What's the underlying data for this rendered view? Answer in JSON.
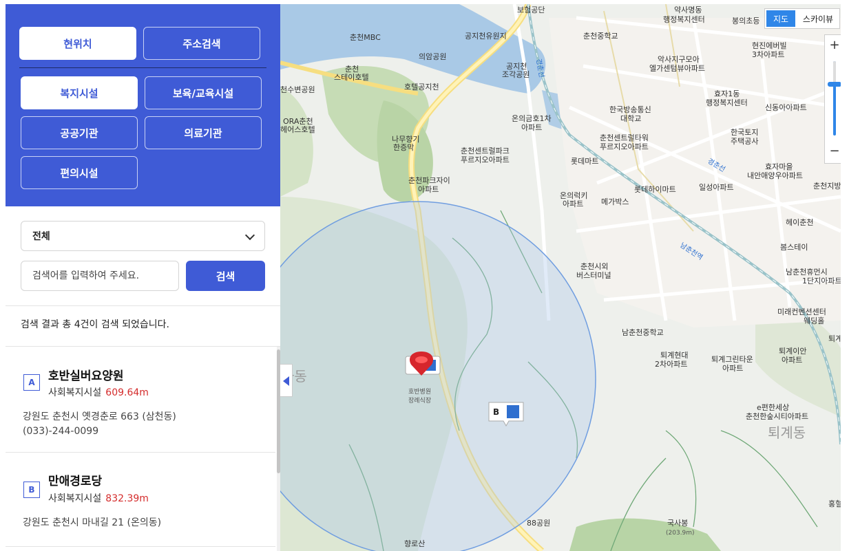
{
  "top_buttons": {
    "current_location": "현위치",
    "address_search": "주소검색"
  },
  "categories": [
    {
      "label": "복지시설"
    },
    {
      "label": "보육/교육시설"
    },
    {
      "label": "공공기관"
    },
    {
      "label": "의료기관"
    },
    {
      "label": "편의시설"
    }
  ],
  "filter": {
    "selected": "전체"
  },
  "search": {
    "placeholder": "검색어를 입력하여 주세요.",
    "button": "검색"
  },
  "result_summary": "검색 결과 총 4건이 검색 되었습니다.",
  "results": [
    {
      "marker": "A",
      "name": "호반실버요양원",
      "category": "사회복지시설",
      "distance": "609.64m",
      "address": "강원도 춘천시 옛경춘로 663 (삼천동)",
      "phone": "(033)-244-0099"
    },
    {
      "marker": "B",
      "name": "만애경로당",
      "category": "사회복지시설",
      "distance": "832.39m",
      "address": "강원도 춘천시 마내길  21 (온의동)"
    }
  ],
  "map": {
    "map_type": {
      "map": "지도",
      "skyview": "스카이뷰"
    },
    "zoom": {
      "plus": "+",
      "minus": "−"
    },
    "marker_b": "B",
    "center_label": [
      "호반병원",
      "장례식장"
    ],
    "labels": [
      [
        "보험공단"
      ],
      [
        "약사명동",
        "행정복지센터"
      ],
      [
        "봉의초등"
      ],
      [
        "춘천MBC"
      ],
      [
        "공지천유원지"
      ],
      [
        "춘천중학교"
      ],
      [
        "의암공원"
      ],
      [
        "현진에버빌",
        "3차아파트"
      ],
      [
        "춘천",
        "스테이호텔"
      ],
      [
        "공지천",
        "조각공원"
      ],
      [
        "악사지구모아",
        "엘가센텀뷰아파트"
      ],
      [
        "호텔공지천"
      ],
      [
        "천수변공원"
      ],
      [
        "효자1동",
        "행정복지센터"
      ],
      [
        "한국방송통신",
        "대학교"
      ],
      [
        "신동아아파트"
      ],
      [
        "ORA춘천",
        "헤어스호텔"
      ],
      [
        "온의금호1차",
        "아파트"
      ],
      [
        "춘천센트럴타워",
        "푸르지오아파트"
      ],
      [
        "나무향기",
        "한증막"
      ],
      [
        "한국토지",
        "주택공사"
      ],
      [
        "춘천센트럴파크",
        "푸르지오아파트"
      ],
      [
        "롯데마트"
      ],
      [
        "효자마을",
        "내안애양우아파트"
      ],
      [
        "춘천파크자이",
        "아파트"
      ],
      [
        "롯데하이마트"
      ],
      [
        "일성아파트"
      ],
      [
        "춘천지방"
      ],
      [
        "온의럭키",
        "아파트"
      ],
      [
        "메가박스"
      ],
      [
        "헤이춘천"
      ],
      [
        "봄스테이"
      ],
      [
        "춘천시외",
        "버스터미널"
      ],
      [
        "남춘천휴먼시",
        "1단지아파트"
      ],
      [
        "미래컨벤션센터",
        "웨딩홀"
      ],
      [
        "남춘천중학교"
      ],
      [
        "퇴계"
      ],
      [
        "퇴계현대",
        "2차아파트"
      ],
      [
        "퇴계그린타운",
        "아파트"
      ],
      [
        "퇴계이안",
        "아파트"
      ],
      [
        "e편한세상",
        "춘천한숲시티아파트"
      ],
      [
        "88공원"
      ],
      [
        "국사봉"
      ],
      [
        "향로산"
      ],
      [
        "홍혈"
      ]
    ],
    "small_labels": [
      "(203.9m)"
    ],
    "road_labels": [
      "남춘천역",
      "경춘선",
      "경춘선"
    ],
    "area_labels": [
      "퇴계동",
      "사동"
    ]
  }
}
